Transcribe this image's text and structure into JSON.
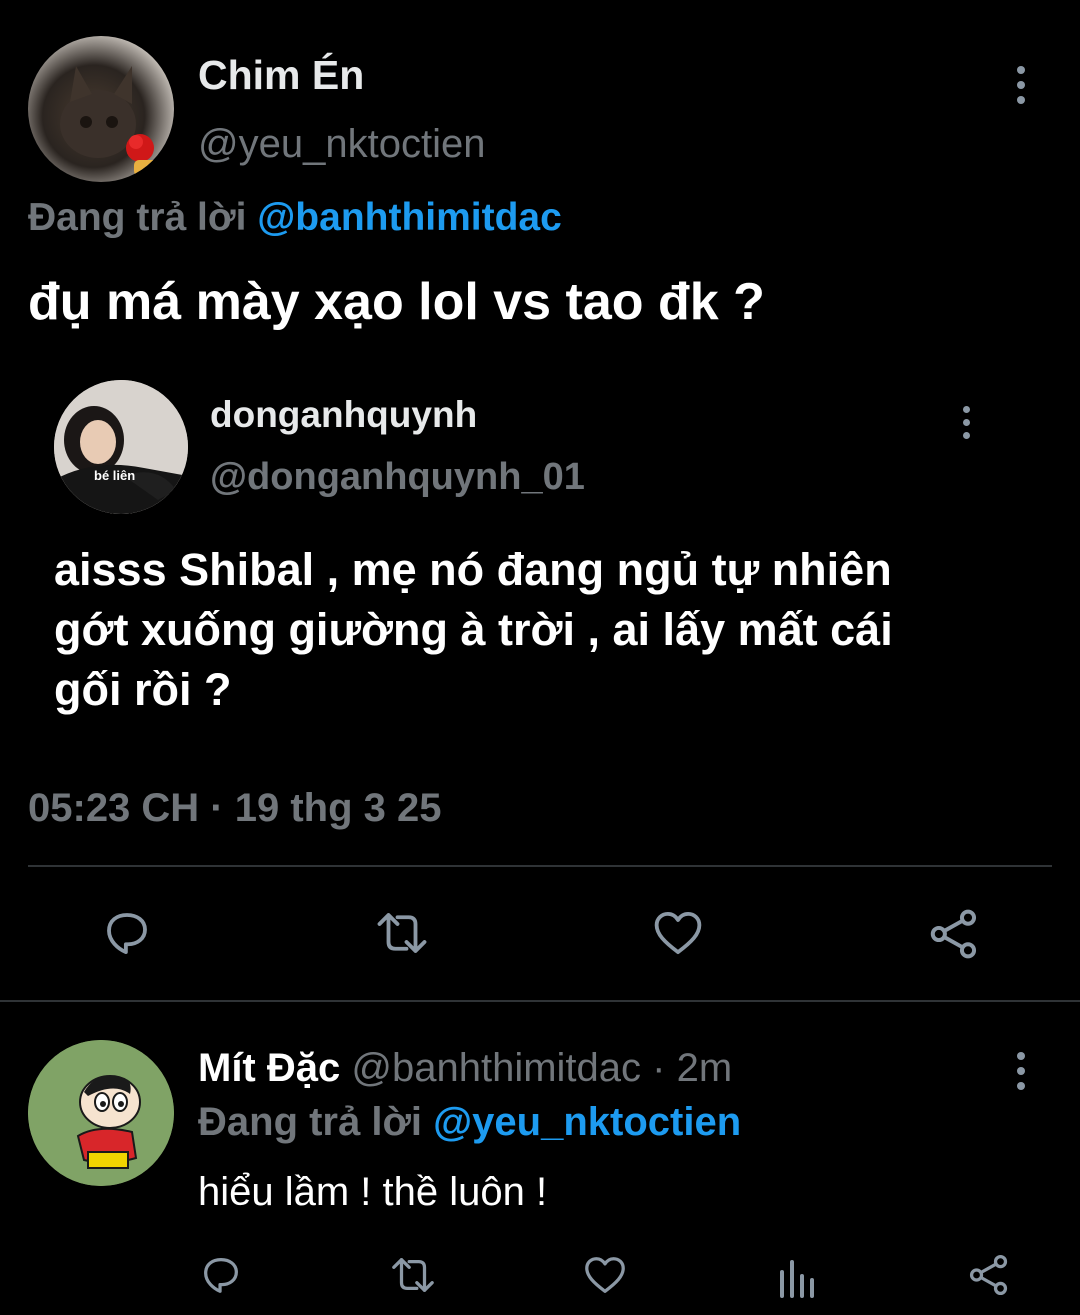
{
  "main_tweet": {
    "display_name": "Chim Én",
    "handle": "@yeu_nktoctien",
    "reply_prefix": "Đang trả lời",
    "reply_to": "@banhthimitdac",
    "text": "đụ má mày xạo lol vs tao đk ?",
    "timestamp": "05:23 CH · 19 thg 3 25"
  },
  "quoted_tweet": {
    "display_name": "donganhquynh",
    "handle": "@donganhquynh_01",
    "avatar_shirt_text": "bé liên",
    "text_line1": "aisss Shibal , mẹ nó đang ngủ tự nhiên",
    "text_line2": "gớt xuống giường à trời , ai lấy mất cái",
    "text_line3": "gối rồi ?"
  },
  "reply_tweet": {
    "display_name": "Mít Đặc",
    "handle": "@banhthimitdac",
    "time": "· 2m",
    "reply_prefix": "Đang trả lời",
    "reply_to": "@yeu_nktoctien",
    "text": "hiểu lầm ! thề luôn !"
  },
  "icons": {
    "reply": "reply-icon",
    "retweet": "retweet-icon",
    "like": "heart-icon",
    "share": "share-icon",
    "views": "views-icon",
    "more": "more-options-icon"
  },
  "colors": {
    "background": "#000000",
    "text": "#e7e9ea",
    "muted": "#71767b",
    "link": "#1d9bf0",
    "icon": "#8b98a5"
  }
}
